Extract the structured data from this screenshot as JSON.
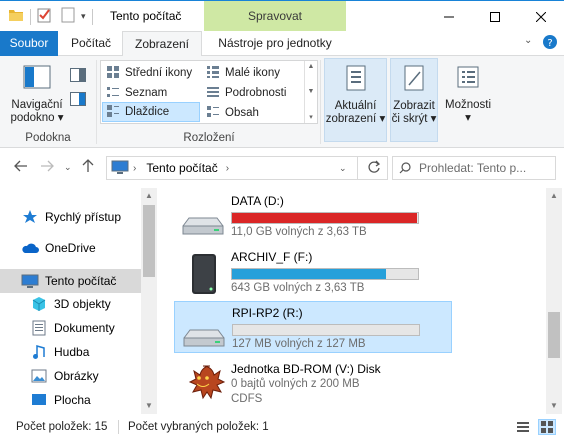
{
  "window": {
    "title": "Tento počítač",
    "context_tab": "Spravovat"
  },
  "ribbon_tabs": {
    "file": "Soubor",
    "computer": "Počítač",
    "view": "Zobrazení",
    "drive_tools": "Nástroje pro jednotky"
  },
  "ribbon": {
    "panes": {
      "nav_pane_label_1": "Navigační",
      "nav_pane_label_2": "podokno",
      "group_label": "Podokna"
    },
    "layout": {
      "items": [
        "Střední ikony",
        "Malé ikony",
        "Seznam",
        "Podrobnosti",
        "Dlaždice",
        "Obsah"
      ],
      "selected": "Dlaždice",
      "group_label": "Rozložení"
    },
    "current_view": {
      "label_1": "Aktuální",
      "label_2": "zobrazení"
    },
    "show_hide": {
      "label_1": "Zobrazit",
      "label_2": "či skrýt"
    },
    "options": {
      "label": "Možnosti"
    }
  },
  "address": {
    "path": "Tento počítač",
    "search_placeholder": "Prohledat: Tento p..."
  },
  "nav_pane": {
    "items": [
      {
        "label": "Rychlý přístup",
        "icon": "star-icon"
      },
      {
        "label": "OneDrive",
        "icon": "cloud-icon"
      },
      {
        "label": "Tento počítač",
        "icon": "computer-icon"
      },
      {
        "label": "3D objekty",
        "icon": "cube-icon"
      },
      {
        "label": "Dokumenty",
        "icon": "document-icon"
      },
      {
        "label": "Hudba",
        "icon": "music-icon"
      },
      {
        "label": "Obrázky",
        "icon": "pictures-icon"
      },
      {
        "label": "Plocha",
        "icon": "desktop-icon"
      }
    ],
    "selected": "Tento počítač"
  },
  "drives": [
    {
      "name": "DATA (D:)",
      "free": "11,0 GB volných z 3,63 TB",
      "used_fraction": 0.997,
      "bar_color": "#da2626",
      "icon": "hard-drive-icon"
    },
    {
      "name": "ARCHIV_F (F:)",
      "free": "643 GB volných z 3,63 TB",
      "used_fraction": 0.827,
      "bar_color": "#26a0da",
      "icon": "external-drive-icon"
    },
    {
      "name": "RPI-RP2 (R:)",
      "free": "127 MB volných z 127 MB",
      "used_fraction": 0.0,
      "bar_color": "#26a0da",
      "icon": "hard-drive-icon"
    },
    {
      "name": "Jednotka BD-ROM (V:) Disk",
      "free": "0 bajtů volných z 200 MB",
      "extra": "CDFS",
      "icon": "dragon-disc-icon"
    }
  ],
  "status": {
    "item_count": "Počet položek: 15",
    "selected_count": "Počet vybraných položek: 1"
  }
}
